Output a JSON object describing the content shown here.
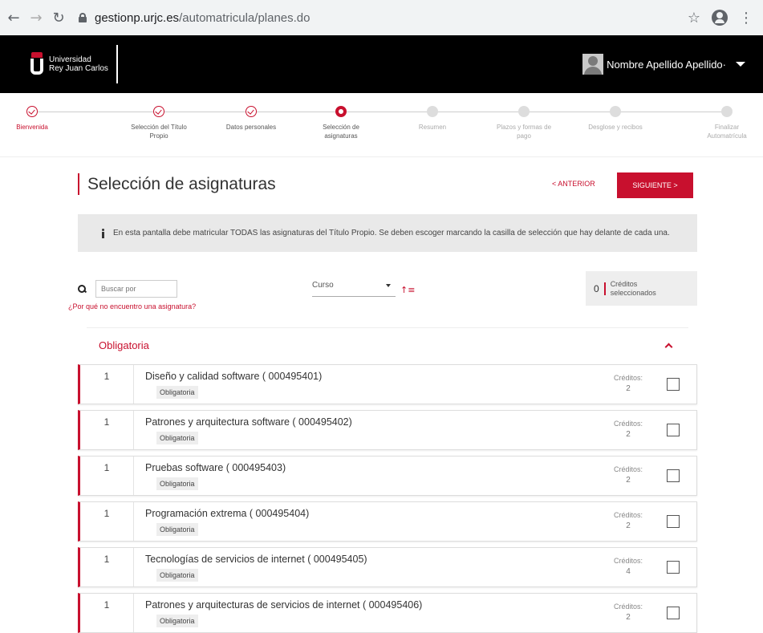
{
  "browser": {
    "url_host": "gestionp.urjc.es",
    "url_path": "/automatricula/planes.do"
  },
  "header": {
    "logo_line1": "Universidad",
    "logo_line2": "Rey Juan Carlos",
    "user_name": "Nombre Apellido Apellido·"
  },
  "stepper": {
    "steps": [
      {
        "label": "Bienvenida",
        "state": "done"
      },
      {
        "label": "Selección del Título Propio",
        "state": "done"
      },
      {
        "label": "Datos personales",
        "state": "done"
      },
      {
        "label": "Selección de asignaturas",
        "state": "current"
      },
      {
        "label": "Resumen",
        "state": "pending"
      },
      {
        "label": "Plazos y formas de pago",
        "state": "pending"
      },
      {
        "label": "Desglose y recibos",
        "state": "pending"
      },
      {
        "label": "Finalizar Automatrícula",
        "state": "pending"
      }
    ]
  },
  "main": {
    "title": "Selección de asignaturas",
    "prev_label": "< ANTERIOR",
    "next_label": "SIGUIENTE >",
    "info_text": "En esta pantalla debe matricular TODAS las asignaturas del Título Propio. Se deben escoger marcando la casilla de selección que hay delante de cada una."
  },
  "filters": {
    "search_placeholder": "Buscar por",
    "search_help_link": "¿Por qué no encuentro una asignatura?",
    "curso_label": "Curso",
    "credits_count": "0",
    "credits_label_1": "Créditos",
    "credits_label_2": "seleccionados"
  },
  "section": {
    "title": "Obligatoria"
  },
  "subjects": [
    {
      "course": "1",
      "name": "Diseño y calidad software ( 000495401)",
      "type": "Obligatoria",
      "credits_label": "Créditos:",
      "credits": "2"
    },
    {
      "course": "1",
      "name": "Patrones y arquitectura software ( 000495402)",
      "type": "Obligatoria",
      "credits_label": "Créditos:",
      "credits": "2"
    },
    {
      "course": "1",
      "name": "Pruebas software ( 000495403)",
      "type": "Obligatoria",
      "credits_label": "Créditos:",
      "credits": "2"
    },
    {
      "course": "1",
      "name": "Programación extrema ( 000495404)",
      "type": "Obligatoria",
      "credits_label": "Créditos:",
      "credits": "2"
    },
    {
      "course": "1",
      "name": "Tecnologías de servicios de internet ( 000495405)",
      "type": "Obligatoria",
      "credits_label": "Créditos:",
      "credits": "4"
    },
    {
      "course": "1",
      "name": "Patrones y arquitecturas de servicios de internet ( 000495406)",
      "type": "Obligatoria",
      "credits_label": "Créditos:",
      "credits": "2"
    }
  ],
  "colors": {
    "accent": "#c8102e",
    "header_bg": "#000000"
  }
}
